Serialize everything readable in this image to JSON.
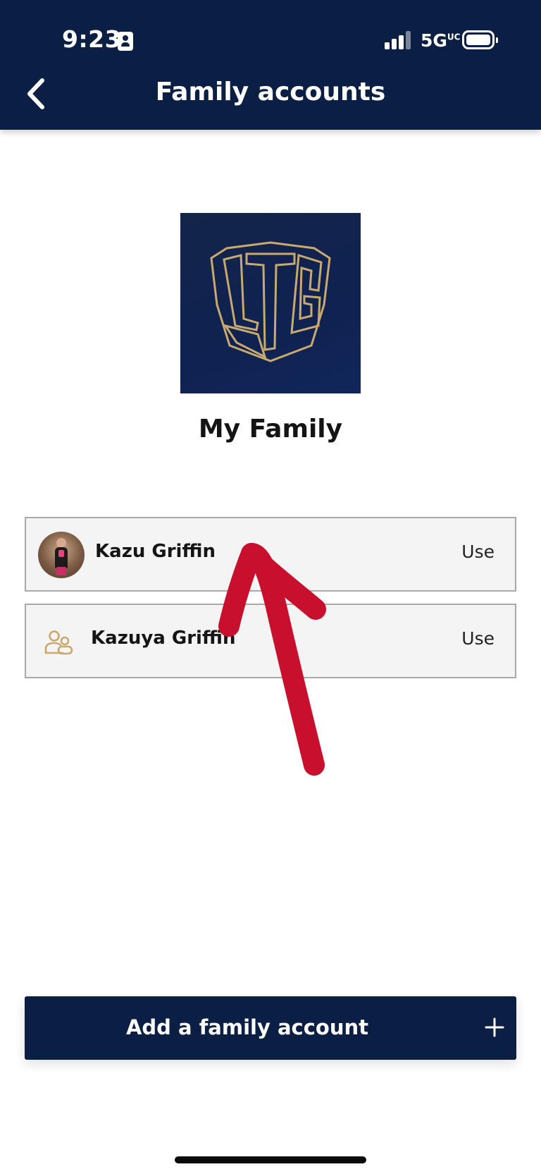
{
  "status_bar": {
    "time": "9:23",
    "network": "5G",
    "network_suffix": "UC"
  },
  "header": {
    "title": "Family accounts"
  },
  "family": {
    "name": "My Family"
  },
  "accounts": [
    {
      "name": "Kazu Griffin",
      "action": "Use"
    },
    {
      "name": "Kazuya Griffin",
      "action": "Use"
    }
  ],
  "footer": {
    "add_label": "Add a family account"
  },
  "colors": {
    "navy": "#0b1f44",
    "gold": "#c9a96e",
    "annotation_red": "#c8102e"
  },
  "icons": [
    "id-card-icon",
    "signal-icon",
    "battery-icon",
    "back-chevron-icon",
    "team-shield-logo",
    "family-group-icon",
    "plus-icon"
  ]
}
